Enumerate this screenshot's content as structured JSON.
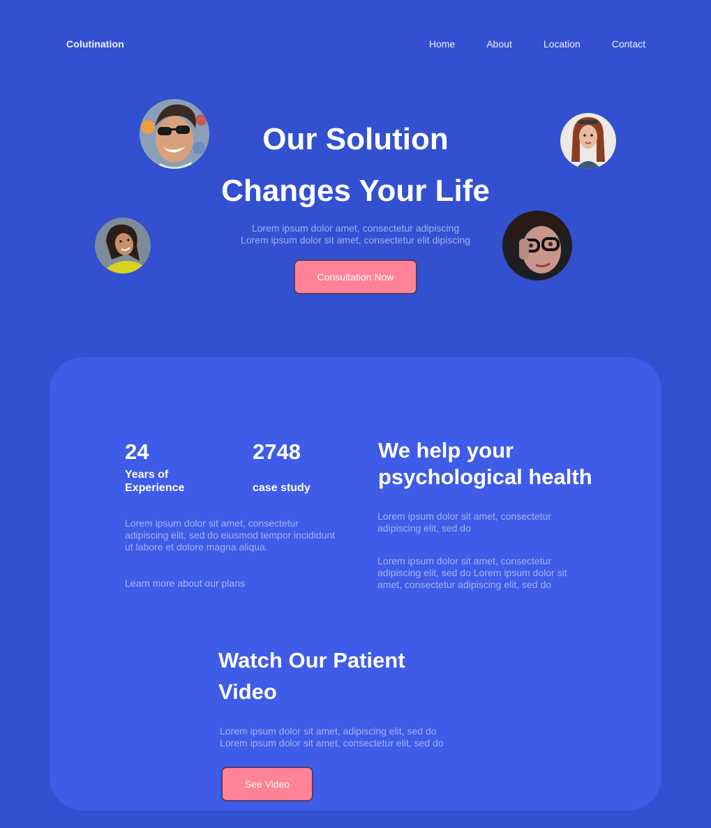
{
  "header": {
    "brand": "Colutination",
    "nav": [
      "Home",
      "About",
      "Location",
      "Contact"
    ]
  },
  "hero": {
    "title_line1": "Our Solution",
    "title_line2": "Changes Your Life",
    "subtitle_line1": "Lorem ipsum dolor amet, consectetur adipiscing",
    "subtitle_line2": "Lorem ipsum dolor sit amet, consectetur elit dipiscing",
    "cta_label": "Consultation Now"
  },
  "stats": [
    {
      "number": "24",
      "label_line1": "Years of",
      "label_line2": "Experience"
    },
    {
      "number": "2748",
      "label_line1": "",
      "label_line2": "case study"
    }
  ],
  "about": {
    "paragraph_lines": [
      "Lorem ipsum dolor sit amet, consectetur",
      "adipiscing elit, sed do eiusmod tempor incididunt",
      "ut labore et dolore magna aliqua."
    ],
    "link": "Learn more about our plans"
  },
  "help": {
    "title_line1": "We help your",
    "title_line2": "psychological health",
    "para1_lines": [
      "Lorem ipsum dolor sit amet, consectetur",
      "adipiscing elit, sed do"
    ],
    "para2_lines": [
      "Lorem ipsum dolor sit amet, consectetur",
      "adipiscing elit, sed do Lorem ipsum dolor sit",
      "amet, consectetur adipiscing elit, sed do"
    ]
  },
  "video": {
    "title_line1": "Watch Our Patient",
    "title_line2": "Video",
    "text_lines": [
      "Lorem ipsum dolor sit amet, adipiscing elit, sed do",
      "Lorem ipsum dolor sit amet, consectetur elit, sed do"
    ],
    "cta_label": "See Video"
  },
  "colors": {
    "background": "#3350d1",
    "card": "#3f5ce8",
    "accent_pink": "#ff8297",
    "muted_text": "#a2b2f0"
  },
  "icons": [
    "avatar-man-sunglasses",
    "avatar-woman-redhead",
    "avatar-woman-yellow",
    "avatar-woman-glasses"
  ]
}
